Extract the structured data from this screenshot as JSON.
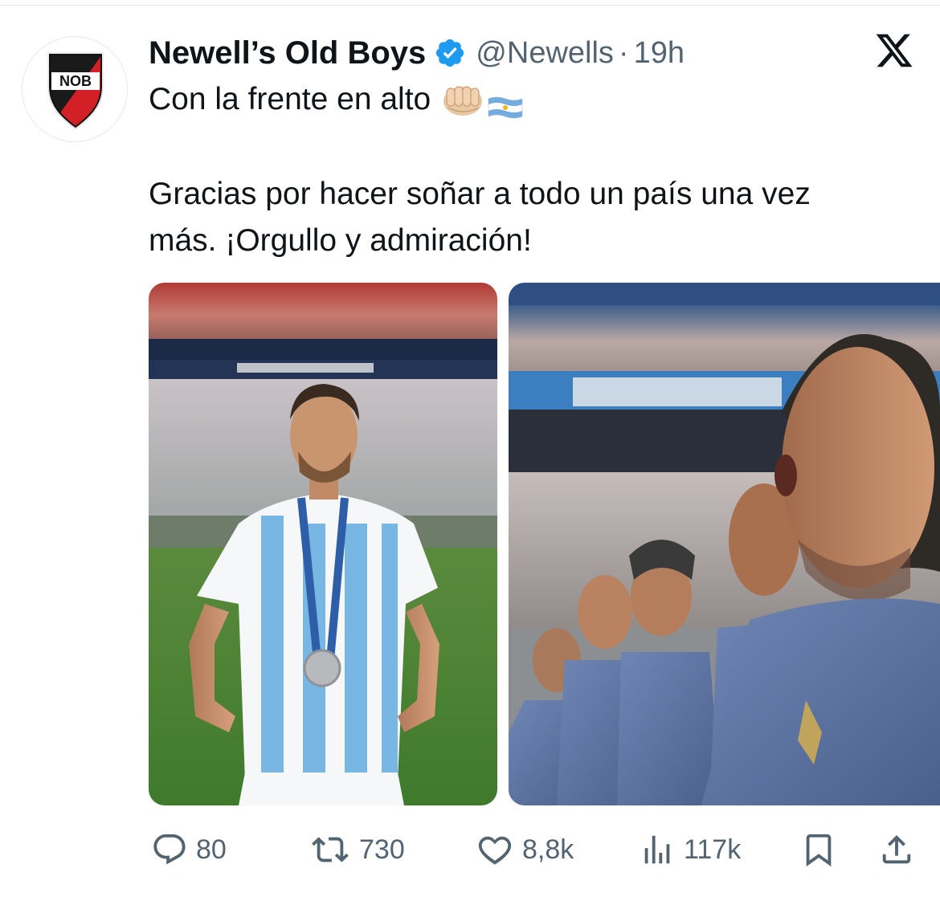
{
  "account": {
    "display_name": "Newell’s Old Boys",
    "handle": "@Newells",
    "separator": "·",
    "time": "19h",
    "verified": true,
    "avatar_text": "NOB"
  },
  "tweet": {
    "line1": "Con la frente en alto",
    "line2": "Gracias por hacer soñar a todo un país una vez",
    "line3": "más. ¡Orgullo y admiración!"
  },
  "stats": {
    "replies": "80",
    "reposts": "730",
    "likes": "8,8k",
    "views": "117k"
  },
  "colors": {
    "verified_blue": "#1d9bf0",
    "icon_gray": "#536471",
    "text": "#0f1419"
  },
  "icons": {
    "platform": "x-logo-icon",
    "reply": "reply-icon",
    "repost": "repost-icon",
    "like": "heart-icon",
    "views": "views-icon",
    "bookmark": "bookmark-icon",
    "share": "share-icon"
  }
}
